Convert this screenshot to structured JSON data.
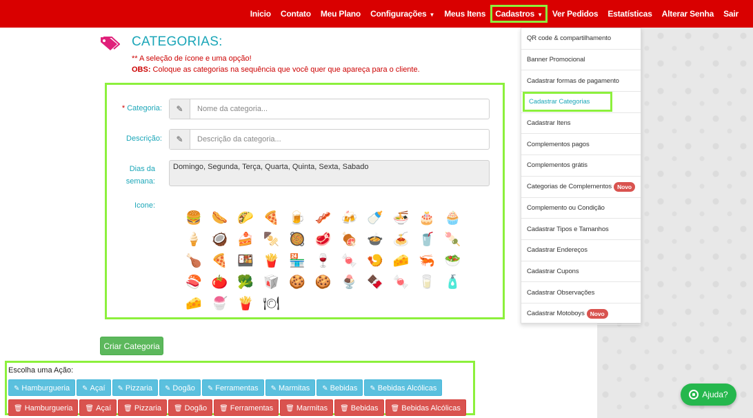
{
  "nav": {
    "items": [
      {
        "label": "Inicio",
        "caret": false,
        "active": false
      },
      {
        "label": "Contato",
        "caret": false,
        "active": false
      },
      {
        "label": "Meu Plano",
        "caret": false,
        "active": false
      },
      {
        "label": "Configurações",
        "caret": true,
        "active": false
      },
      {
        "label": "Meus Itens",
        "caret": false,
        "active": false
      },
      {
        "label": "Cadastros",
        "caret": true,
        "active": true
      },
      {
        "label": "Ver Pedidos",
        "caret": false,
        "active": false
      },
      {
        "label": "Estatísticas",
        "caret": false,
        "active": false
      },
      {
        "label": "Alterar Senha",
        "caret": false,
        "active": false
      },
      {
        "label": "Sair",
        "caret": false,
        "active": false
      }
    ],
    "caret_glyph": "▼"
  },
  "heading": {
    "title": "CATEGORIAS:",
    "note_icon": "** A seleção de ícone e uma opção!",
    "note_obs_label": "OBS:",
    "note_obs_text": " Coloque as categorias na sequência que você quer que apareça para o cliente."
  },
  "form": {
    "category_required_mark": "*",
    "category_label": "Categoria:",
    "category_placeholder": "Nome da categoria...",
    "description_label": "Descrição:",
    "description_placeholder": "Descrição da categoria...",
    "days_label": "Dias da semana:",
    "days_value": "Domingo, Segunda, Terça, Quarta, Quinta, Sexta, Sabado",
    "icon_label": "Icone:",
    "edit_glyph": "✎",
    "icons": [
      "🍔",
      "🌭",
      "🌮",
      "🍕",
      "🍺",
      "🥓",
      "🍻",
      "🍼",
      "🍜",
      "🎂",
      "🧁",
      "🍦",
      "🥥",
      "🍰",
      "🍢",
      "🥘",
      "🥩",
      "🍖",
      "🍲",
      "🍝",
      "🥤",
      "🍡",
      "🍗",
      "🍕",
      "🍱",
      "🍟",
      "🏪",
      "🍷",
      "🍬",
      "🍤",
      "🧀",
      "🦐",
      "🥗",
      "🍣",
      "🍅",
      "🥦",
      "🥡",
      "🍪",
      "🍪",
      "🍨",
      "🍫",
      "🍬",
      "🥛",
      "🧴",
      "🧀",
      "🍧",
      "🍟",
      "🍽"
    ]
  },
  "create_button": "Criar Categoria",
  "actions": {
    "title": "Escolha uma Ação:",
    "edit_glyph": "✎",
    "delete_glyph": "🗑",
    "categories": [
      "Hamburgueria",
      "Açaí",
      "Pizzaria",
      "Dogão",
      "Ferramentas",
      "Marmitas",
      "Bebidas",
      "Bebidas Alcólicas"
    ]
  },
  "dropdown": {
    "items": [
      {
        "label": "QR code & compartilhamento",
        "badge": "",
        "highlight": false
      },
      {
        "label": "Banner Promocional",
        "badge": "",
        "highlight": false
      },
      {
        "label": "Cadastrar formas de pagamento",
        "badge": "",
        "highlight": false
      },
      {
        "label": "Cadastrar Categorias",
        "badge": "",
        "highlight": true
      },
      {
        "label": "Cadastrar Itens",
        "badge": "",
        "highlight": false
      },
      {
        "label": "Complementos pagos",
        "badge": "",
        "highlight": false
      },
      {
        "label": "Complementos grátis",
        "badge": "",
        "highlight": false
      },
      {
        "label": "Categorias de Complementos",
        "badge": "Novo",
        "highlight": false
      },
      {
        "label": "Complemento ou Condição",
        "badge": "",
        "highlight": false
      },
      {
        "label": "Cadastrar Tipos e Tamanhos",
        "badge": "",
        "highlight": false
      },
      {
        "label": "Cadastrar Endereços",
        "badge": "",
        "highlight": false
      },
      {
        "label": "Cadastrar Cupons",
        "badge": "",
        "highlight": false
      },
      {
        "label": "Cadastrar Observações",
        "badge": "",
        "highlight": false
      },
      {
        "label": "Cadastrar Motoboys",
        "badge": "Novo",
        "highlight": false
      }
    ]
  },
  "help_button": "Ajuda?",
  "colors": {
    "navbar": "#d90000",
    "accent_teal": "#1ba6b8",
    "highlight_frame": "#8cf03c",
    "edit_button": "#5bc0de",
    "delete_button": "#d9534f",
    "create_button": "#5cb85c",
    "help_button": "#25b74d"
  }
}
